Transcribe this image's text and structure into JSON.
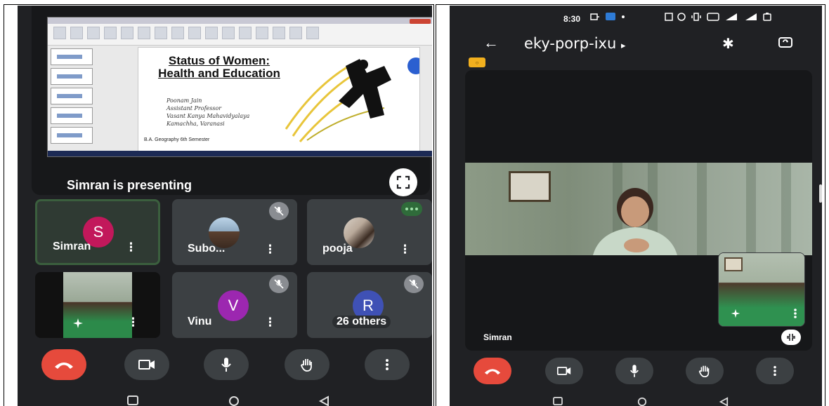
{
  "left_phone": {
    "presentation": {
      "slide_title": "Status of Women: Health and Education",
      "slide_handwriting": [
        "Poonam Jain",
        "Assistant Professor",
        "Vasant Kanya Mahavidyalaya",
        "Kamachha, Varanasi"
      ],
      "slide_footer": "B.A. Geography 6th Semester",
      "presenting_text": "Simran  is presenting"
    },
    "participants": [
      {
        "name": "Simran",
        "initial": "S",
        "color": "#c2185b"
      },
      {
        "name": "Subo...",
        "initial": "",
        "muted": true
      },
      {
        "name": "pooja",
        "initial": "",
        "speaking": true
      },
      {
        "name": "",
        "initial": ""
      },
      {
        "name": "Vinu",
        "initial": "V",
        "color": "#9c27b0",
        "muted": true
      },
      {
        "name": "26 others",
        "initial": "R",
        "color": "#3f51b5",
        "muted": true
      }
    ],
    "more_glyph": "⋮"
  },
  "right_phone": {
    "status": {
      "time": "8:30"
    },
    "meeting_code": "eky-porp-ixu",
    "code_caret": "▸",
    "back_glyph": "←",
    "bluetooth_glyph": "✱",
    "speaker_name": "Simran"
  },
  "colors": {
    "bg": "#202124",
    "tile": "#3c4043",
    "end_call": "#e64a3c"
  }
}
